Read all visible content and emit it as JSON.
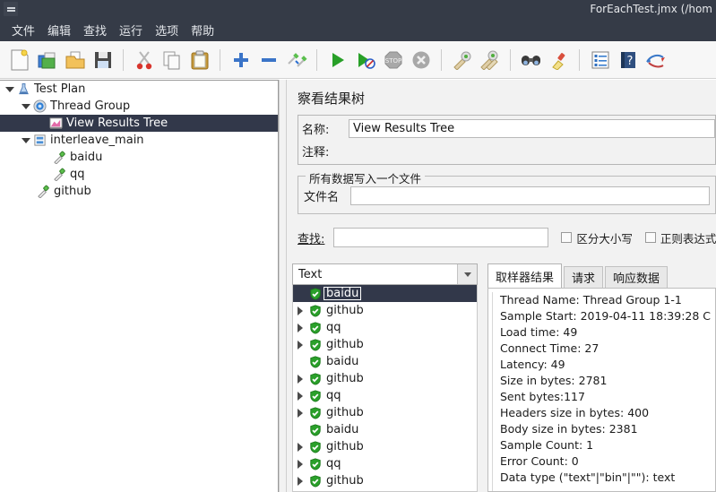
{
  "window": {
    "title": "ForEachTest.jmx (/hom",
    "handle_icon": "hamburger-icon"
  },
  "menu": {
    "items": [
      {
        "label": "文件"
      },
      {
        "label": "编辑"
      },
      {
        "label": "查找"
      },
      {
        "label": "运行"
      },
      {
        "label": "选项"
      },
      {
        "label": "帮助"
      }
    ]
  },
  "toolbar": {
    "buttons": [
      {
        "name": "new-icon",
        "label": "New"
      },
      {
        "name": "templates-icon",
        "label": "Templates"
      },
      {
        "name": "open-icon",
        "label": "Open"
      },
      {
        "name": "save-icon",
        "label": "Save"
      },
      {
        "name": "cut-icon",
        "label": "Cut"
      },
      {
        "name": "copy-icon",
        "label": "Copy"
      },
      {
        "name": "paste-icon",
        "label": "Paste"
      },
      {
        "name": "expand-all-icon",
        "label": "Expand All"
      },
      {
        "name": "collapse-all-icon",
        "label": "Collapse All"
      },
      {
        "name": "toggle-icon",
        "label": "Toggle"
      },
      {
        "name": "start-icon",
        "label": "Start"
      },
      {
        "name": "start-no-pauses-icon",
        "label": "Start no pauses"
      },
      {
        "name": "stop-icon",
        "label": "Stop"
      },
      {
        "name": "shutdown-icon",
        "label": "Shutdown"
      },
      {
        "name": "clear-icon",
        "label": "Clear"
      },
      {
        "name": "clear-all-icon",
        "label": "Clear All"
      },
      {
        "name": "search-icon",
        "label": "Search"
      },
      {
        "name": "reset-search-icon",
        "label": "Reset Search"
      },
      {
        "name": "function-helper-icon",
        "label": "Function Helper"
      },
      {
        "name": "help-icon",
        "label": "Help"
      },
      {
        "name": "undo-redo-icon",
        "label": "Undo"
      }
    ]
  },
  "tree": {
    "nodes": [
      {
        "label": "Test Plan",
        "depth": 0,
        "arrow": "down",
        "icon": "test-plan-icon",
        "selected": false
      },
      {
        "label": "Thread Group",
        "depth": 1,
        "arrow": "down",
        "icon": "thread-group-icon",
        "selected": false
      },
      {
        "label": "View Results Tree",
        "depth": 2,
        "arrow": "none",
        "icon": "view-results-tree-icon",
        "selected": true
      },
      {
        "label": "interleave_main",
        "depth": 1,
        "arrow": "down",
        "icon": "interleave-icon",
        "selected": false
      },
      {
        "label": "baidu",
        "depth": 2,
        "arrow": "none",
        "icon": "sampler-icon",
        "selected": false
      },
      {
        "label": "qq",
        "depth": 2,
        "arrow": "none",
        "icon": "sampler-icon",
        "selected": false
      },
      {
        "label": "github",
        "depth": 1,
        "arrow": "none",
        "icon": "sampler-icon",
        "selected": false
      }
    ]
  },
  "panel": {
    "title": "察看结果树",
    "name_label": "名称:",
    "name_value": "View Results Tree",
    "comment_label": "注释:",
    "comment_value": "",
    "file_group_title": "所有数据写入一个文件",
    "filename_label": "文件名",
    "filename_value": "",
    "find_label": "查找:",
    "find_value": "",
    "checkboxes": [
      {
        "label": "区分大小写",
        "checked": false
      },
      {
        "label": "正则表达式",
        "checked": false
      }
    ]
  },
  "renderer": {
    "selected": "Text",
    "chevron_icon": "chevron-down-icon"
  },
  "results": [
    {
      "label": "baidu",
      "expandable": false,
      "selected": true,
      "status": "success"
    },
    {
      "label": "github",
      "expandable": true,
      "selected": false,
      "status": "success"
    },
    {
      "label": "qq",
      "expandable": true,
      "selected": false,
      "status": "success"
    },
    {
      "label": "github",
      "expandable": true,
      "selected": false,
      "status": "success"
    },
    {
      "label": "baidu",
      "expandable": false,
      "selected": false,
      "status": "success"
    },
    {
      "label": "github",
      "expandable": true,
      "selected": false,
      "status": "success"
    },
    {
      "label": "qq",
      "expandable": true,
      "selected": false,
      "status": "success"
    },
    {
      "label": "github",
      "expandable": true,
      "selected": false,
      "status": "success"
    },
    {
      "label": "baidu",
      "expandable": false,
      "selected": false,
      "status": "success"
    },
    {
      "label": "github",
      "expandable": true,
      "selected": false,
      "status": "success"
    },
    {
      "label": "qq",
      "expandable": true,
      "selected": false,
      "status": "success"
    },
    {
      "label": "github",
      "expandable": true,
      "selected": false,
      "status": "success"
    }
  ],
  "detail": {
    "tabs": [
      {
        "label": "取样器结果",
        "active": true
      },
      {
        "label": "请求",
        "active": false
      },
      {
        "label": "响应数据",
        "active": false
      }
    ],
    "lines": [
      "Thread Name: Thread Group 1-1",
      "Sample Start: 2019-04-11 18:39:28 C",
      "Load time: 49",
      "Connect Time: 27",
      "Latency: 49",
      "Size in bytes: 2781",
      "Sent bytes:117",
      "Headers size in bytes: 400",
      "Body size in bytes: 2381",
      "Sample Count: 1",
      "Error Count: 0",
      "Data type (\"text\"|\"bin\"|\"\"): text"
    ]
  },
  "colors": {
    "titlebar_bg": "#353b47",
    "selection_bg": "#32384a",
    "toolbar_bg": "#f7f7f7",
    "panel_bg": "#f2f2f2",
    "success_green": "#2aa02a"
  }
}
